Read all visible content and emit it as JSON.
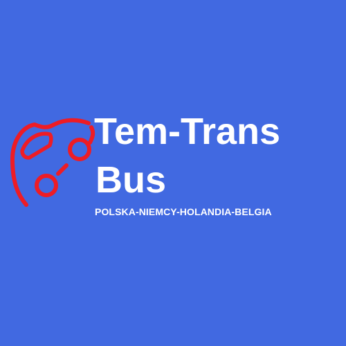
{
  "logo": {
    "title_line_1": "Tem-Trans",
    "title_line_2": "Bus",
    "tagline": "POLSKA-NIEMCY-HOLANDIA-BELGIA",
    "icon": "car-icon"
  },
  "colors": {
    "background": "#4169e1",
    "text": "#ffffff",
    "icon": "#ee1c25"
  }
}
